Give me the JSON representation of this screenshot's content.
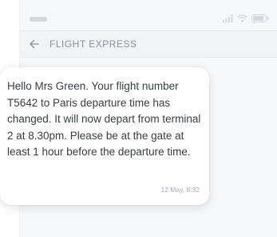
{
  "status_bar": {
    "icons": [
      "signal-icon",
      "wifi-icon",
      "battery-icon"
    ]
  },
  "header": {
    "back_icon": "arrow-left-icon",
    "title": "FLIGHT EXPRESS"
  },
  "message": {
    "text": "Hello Mrs Green. Your flight number T5642 to Paris departure time has changed. It will now depart from terminal 2 at 8.30pm. Please be at the gate at least 1 hour before the departure time.",
    "timestamp": "12 May, 8:32"
  },
  "colors": {
    "header_background": "#f1f3f5",
    "header_text": "#8a9099",
    "bubble_background": "#ffffff",
    "message_text": "#3a3d41",
    "timestamp_text": "#a6abb2",
    "status_icons": "#d3d8de"
  }
}
